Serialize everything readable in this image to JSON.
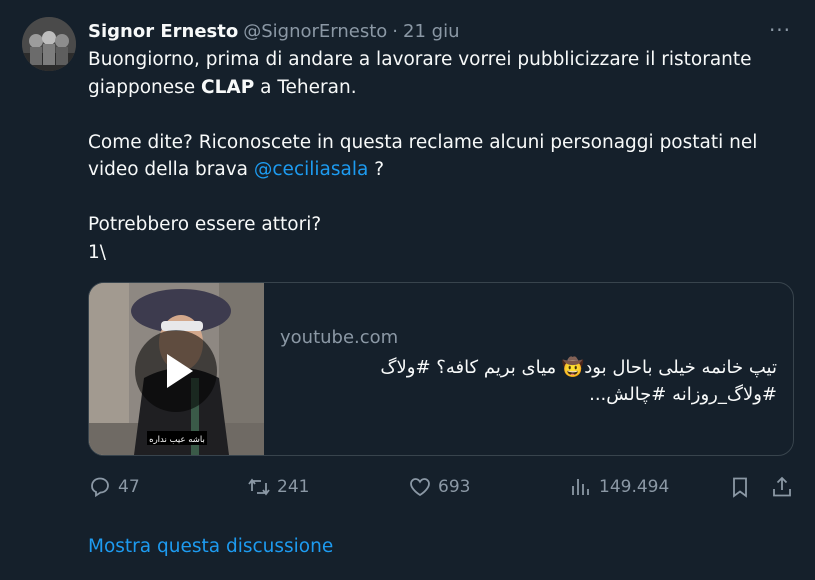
{
  "tweet": {
    "author_name": "Signor Ernesto",
    "handle": "@SignorErnesto",
    "separator": "·",
    "date": "21 giu",
    "more_label": "···",
    "text": {
      "line1": "Buongiorno, prima di andare a lavorare vorrei pubblicizzare il ristorante",
      "line2_before": "giapponese ",
      "line2_bold": "CLAP",
      "line2_after": " a Teheran.",
      "line3": "Come dite? Riconoscete in questa reclame alcuni personaggi postati nel",
      "line4_before": "video della brava ",
      "line4_link": "@ceciliasala",
      "line4_after": " ?",
      "line5": "Potrebbero essere attori?",
      "line6": "1\\"
    }
  },
  "card": {
    "domain": "youtube.com",
    "title": "تیپ خانمه خیلی باحال بود🤠 میای بریم کافه؟ #ولاگ #ولاگ_روزانه #چالش...",
    "thumbnail_caption": "باشه عیب نداره"
  },
  "actions": {
    "replies": "47",
    "reposts": "241",
    "likes": "693",
    "views": "149.494"
  },
  "footer": {
    "show_thread": "Mostra questa discussione"
  },
  "icons": [
    "reply-icon",
    "repost-icon",
    "like-icon",
    "views-icon",
    "bookmark-icon",
    "share-icon",
    "play-icon",
    "more-icon"
  ]
}
